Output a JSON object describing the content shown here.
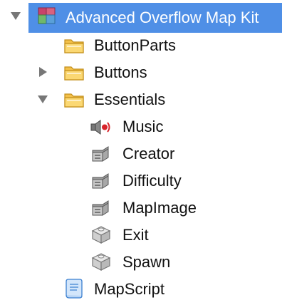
{
  "tree": {
    "root": {
      "label": "Advanced Overflow Map Kit",
      "icon": "model-icon",
      "expanded": true,
      "selected": true
    },
    "items": [
      {
        "label": "ButtonParts",
        "icon": "folder-icon",
        "expanded": null
      },
      {
        "label": "Buttons",
        "icon": "folder-icon",
        "expanded": false
      },
      {
        "label": "Essentials",
        "icon": "folder-icon",
        "expanded": true
      },
      {
        "label": "Music",
        "icon": "sound-icon"
      },
      {
        "label": "Creator",
        "icon": "value-icon"
      },
      {
        "label": "Difficulty",
        "icon": "value-icon"
      },
      {
        "label": "MapImage",
        "icon": "value-icon"
      },
      {
        "label": "Exit",
        "icon": "part-icon"
      },
      {
        "label": "Spawn",
        "icon": "part-icon"
      },
      {
        "label": "MapScript",
        "icon": "script-icon"
      }
    ]
  },
  "colors": {
    "selection": "#4f8fe6",
    "folder": "#f5c542",
    "text": "#111111"
  }
}
